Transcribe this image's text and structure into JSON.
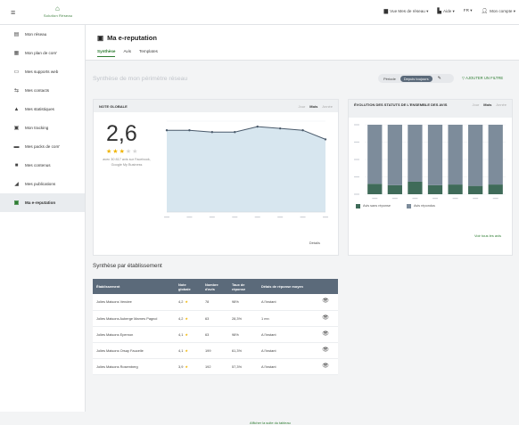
{
  "topbar": {
    "logo_text": "Solution Réseau",
    "nav": [
      {
        "icon": "store-icon",
        "label": "Vue Mes de réseau ▾"
      },
      {
        "icon": "book-icon",
        "label": "Aide ▾"
      },
      {
        "icon": "",
        "label": "FR ▾"
      },
      {
        "icon": "user-icon",
        "label": "Mon compte ▾"
      }
    ]
  },
  "sidebar": {
    "items": [
      {
        "icon": "▤",
        "label": "Mon réseau"
      },
      {
        "icon": "▦",
        "label": "Mon plan de com'"
      },
      {
        "icon": "▭",
        "label": "Mes supports web"
      },
      {
        "icon": "⇆",
        "label": "Mes contacts"
      },
      {
        "icon": "▲",
        "label": "Mes statistiques"
      },
      {
        "icon": "▣",
        "label": "Mon tracking"
      },
      {
        "icon": "▬",
        "label": "Mes packs de com'"
      },
      {
        "icon": "■",
        "label": "Mes contenus"
      },
      {
        "icon": "◢",
        "label": "Mes publications"
      },
      {
        "icon": "▣",
        "label": "Ma e-reputation"
      }
    ],
    "active_index": 9
  },
  "page": {
    "title_icon": "▣",
    "title": "Ma e-reputation",
    "tabs": [
      "Synthèse",
      "Avis",
      "Templates"
    ],
    "active_tab": 0,
    "section_title": "Synthèse de mon périmètre réseau",
    "period_label": "Période",
    "period_value": "Depuis toujours",
    "add_filter": "▽ AJOUTER UN FILTRE"
  },
  "note_card": {
    "header": "NOTE GLOBALE",
    "periods": [
      "Jour",
      "Mois",
      "Année"
    ],
    "active_period": 1,
    "score": "2,6",
    "stars_on": 3,
    "stars_total": 5,
    "note": "avec 30 817 avis sur Facebook, Google My Business",
    "details": "Détails"
  },
  "status_card": {
    "header": "ÉVOLUTION DES STATUTS DE L'ENSEMBLE DES AVIS",
    "periods": [
      "Jour",
      "Mois",
      "Année"
    ],
    "active_period": 1,
    "legend": [
      {
        "label": "Avis sans réponse",
        "color": "#3f6b59"
      },
      {
        "label": "Avis répondus",
        "color": "#7d8c9b"
      }
    ],
    "see_all": "Voir tous les avis"
  },
  "chart_data": [
    {
      "type": "line",
      "y": [
        4.5,
        4.5,
        4.4,
        4.4,
        4.7,
        4.6,
        4.5,
        4.0
      ],
      "ylim": [
        0,
        5
      ]
    },
    {
      "type": "bar",
      "series": [
        {
          "name": "Avis sans réponse",
          "values": [
            15,
            13,
            18,
            13,
            14,
            12,
            14
          ]
        },
        {
          "name": "Avis répondus",
          "values": [
            85,
            87,
            82,
            87,
            86,
            88,
            86
          ]
        }
      ],
      "ylim": [
        0,
        100
      ]
    }
  ],
  "table": {
    "title": "Synthèse par établissement",
    "headers": [
      "Établissement",
      "Note globale",
      "Nombre d'avis",
      "Taux de réponse",
      "Délais de réponse moyen",
      ""
    ],
    "rows": [
      {
        "name": "Jolies Maisons Vendee",
        "note": "4,2",
        "count": "78",
        "rate": "98%",
        "delay": "A l'instant"
      },
      {
        "name": "Jolies Maisons Auberge Marnes Pagnol",
        "note": "4,2",
        "count": "63",
        "rate": "28,3%",
        "delay": "1 mn"
      },
      {
        "name": "Jolies Maisons Epernon",
        "note": "4,1",
        "count": "63",
        "rate": "98%",
        "delay": "A l'instant"
      },
      {
        "name": "Jolies Maisons Orsay Faucelle",
        "note": "4,1",
        "count": "199",
        "rate": "61,3%",
        "delay": "A l'instant"
      },
      {
        "name": "Jolies Maisons Rosemberg",
        "note": "3,9",
        "count": "192",
        "rate": "57,3%",
        "delay": "A l'instant"
      }
    ],
    "show_list": "Afficher la suite du tableau"
  }
}
